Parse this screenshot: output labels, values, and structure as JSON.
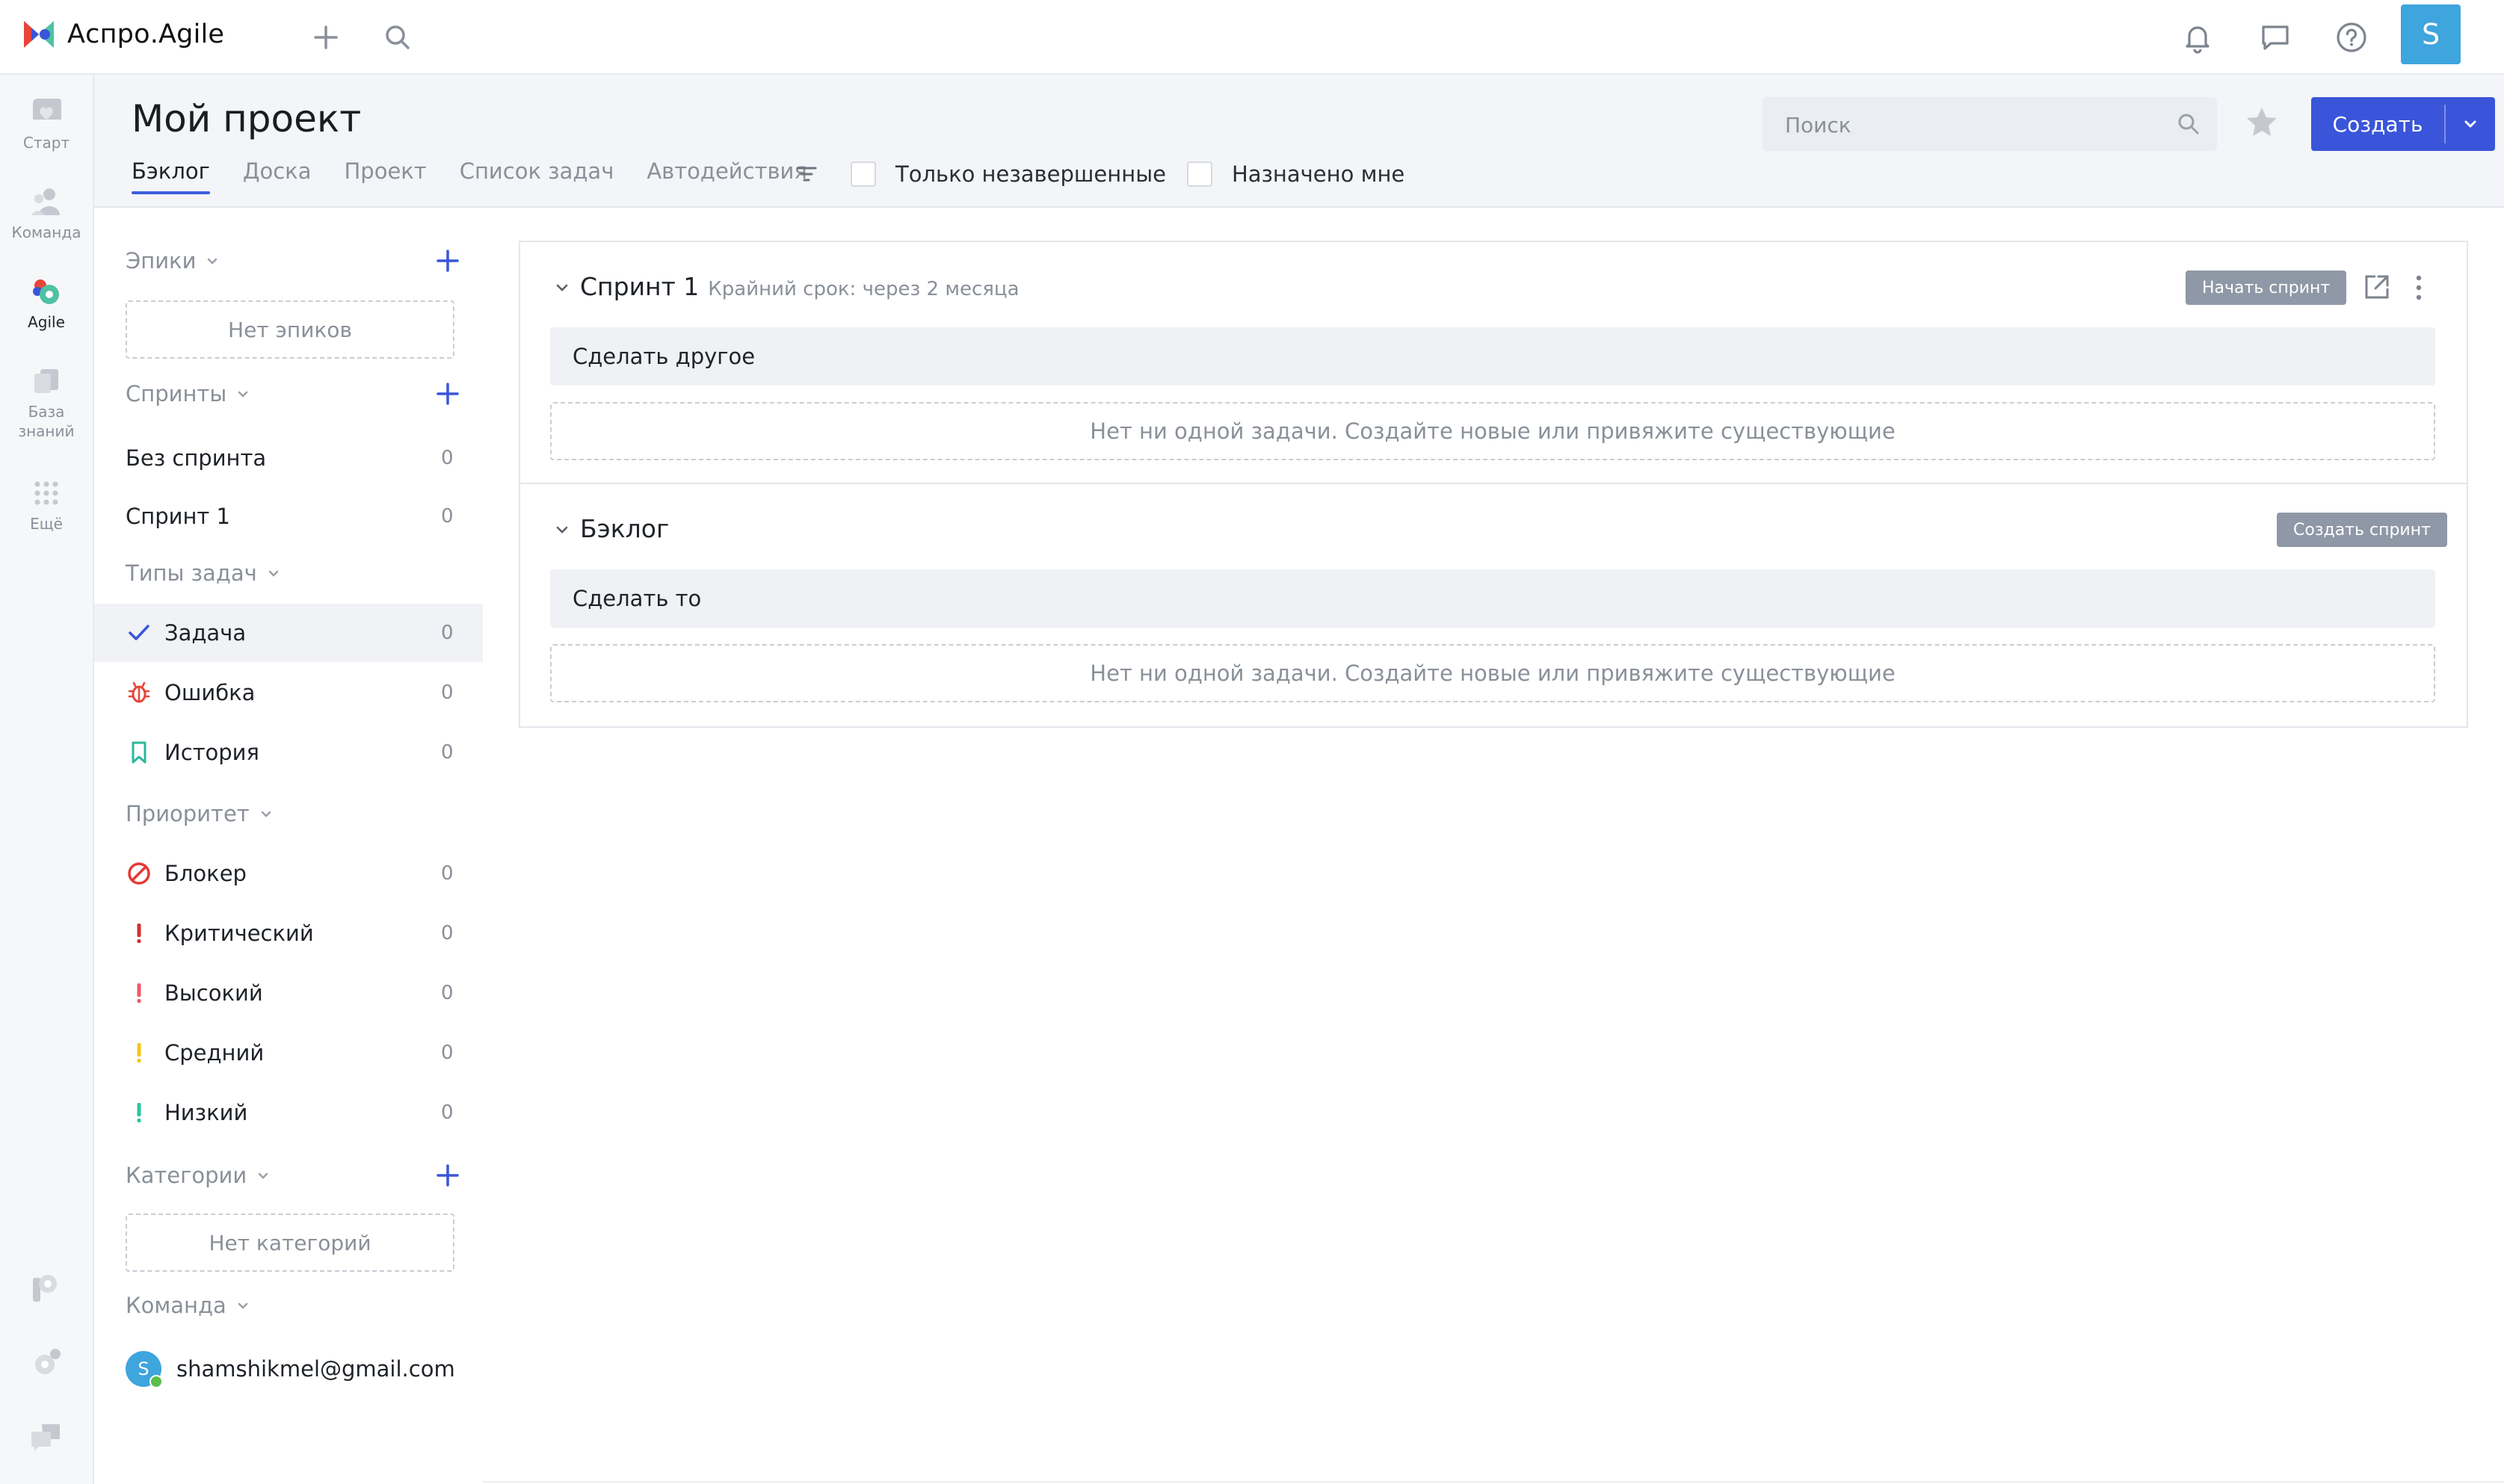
{
  "app": {
    "name": "Аспро.Agile",
    "user_initial": "S"
  },
  "rail": {
    "items": [
      {
        "label": "Старт",
        "icon": "heart-icon"
      },
      {
        "label": "Команда",
        "icon": "team-icon"
      },
      {
        "label": "Agile",
        "icon": "agile-icon",
        "active": true
      },
      {
        "label": "База знаний",
        "icon": "knowledge-base-icon"
      },
      {
        "label": "Ещё",
        "icon": "grid-dots-icon"
      }
    ]
  },
  "header": {
    "title": "Мой проект",
    "tabs": [
      "Бэклог",
      "Доска",
      "Проект",
      "Список задач",
      "Автодействия"
    ],
    "active_tab": "Бэклог",
    "filters": {
      "only_unfinished": "Только незавершенные",
      "assigned_to_me": "Назначено мне"
    },
    "search_placeholder": "Поиск",
    "create_label": "Создать"
  },
  "sidebar": {
    "epics": {
      "title": "Эпики",
      "empty": "Нет эпиков"
    },
    "sprints": {
      "title": "Спринты",
      "items": [
        {
          "label": "Без спринта",
          "count": "0"
        },
        {
          "label": "Спринт 1",
          "count": "0"
        }
      ]
    },
    "task_types": {
      "title": "Типы задач",
      "items": [
        {
          "label": "Задача",
          "count": "0",
          "icon": "check-icon",
          "selected": true
        },
        {
          "label": "Ошибка",
          "count": "0",
          "icon": "bug-icon"
        },
        {
          "label": "История",
          "count": "0",
          "icon": "bookmark-icon"
        }
      ]
    },
    "priority": {
      "title": "Приоритет",
      "items": [
        {
          "label": "Блокер",
          "count": "0",
          "icon": "blocker-icon",
          "color": "#e53935"
        },
        {
          "label": "Критический",
          "count": "0",
          "icon": "exclamation-icon",
          "color": "#d32f2f"
        },
        {
          "label": "Высокий",
          "count": "0",
          "icon": "exclamation-icon",
          "color": "#f0596b"
        },
        {
          "label": "Средний",
          "count": "0",
          "icon": "exclamation-icon",
          "color": "#f5c518"
        },
        {
          "label": "Низкий",
          "count": "0",
          "icon": "exclamation-icon",
          "color": "#2bc4a4"
        }
      ]
    },
    "categories": {
      "title": "Категории",
      "empty": "Нет категорий"
    },
    "team": {
      "title": "Команда",
      "members": [
        {
          "initial": "S",
          "email": "shamshikmel@gmail.com"
        }
      ]
    }
  },
  "board": {
    "sprint": {
      "name": "Спринт 1",
      "deadline": "Крайний срок: через 2 месяца",
      "start_button": "Начать спринт",
      "tasks": [
        "Сделать другое"
      ],
      "empty_text": "Нет ни одной задачи. Создайте новые или привяжите существующие"
    },
    "backlog": {
      "name": "Бэклог",
      "create_button": "Создать спринт",
      "tasks": [
        "Сделать то"
      ],
      "empty_text": "Нет ни одной задачи. Создайте новые или привяжите существующие"
    }
  },
  "colors": {
    "accent": "#3a55d9",
    "avatar": "#3ea5dd",
    "muted_text": "#8a9099"
  }
}
